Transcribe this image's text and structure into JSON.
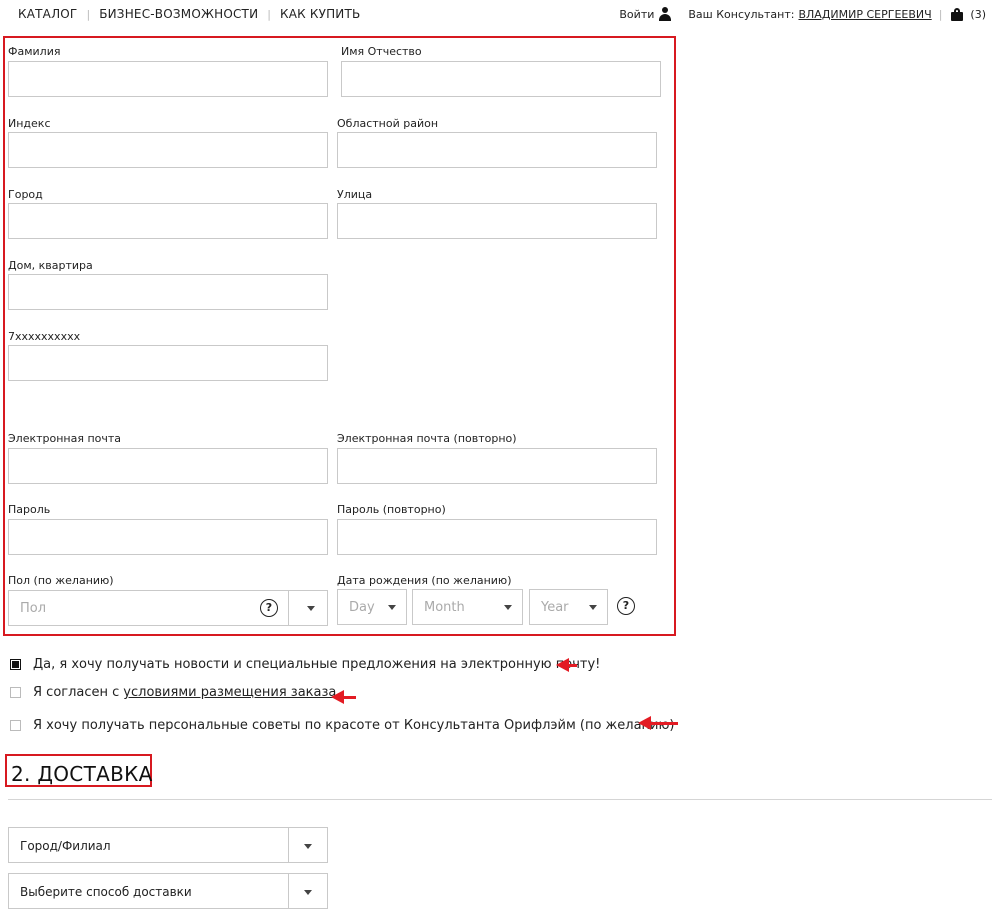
{
  "nav": {
    "items": [
      "КАТАЛОГ",
      "БИЗНЕС-ВОЗМОЖНОСТИ",
      "КАК КУПИТЬ"
    ],
    "login": "Войти",
    "consultant_label": "Ваш Консультант:",
    "consultant_name": "ВЛАДИМИР СЕРГЕЕВИЧ",
    "cart_count": "(3)"
  },
  "form": {
    "last_name_label": "Фамилия",
    "first_name_label": "Имя Отчество",
    "index_label": "Индекс",
    "region_label": "Областной район",
    "city_label": "Город",
    "street_label": "Улица",
    "house_label": "Дом, квартира",
    "phone_label": "7xxxxxxxxxx",
    "email_label": "Электронная почта",
    "email_repeat_label": "Электронная почта (повторно)",
    "password_label": "Пароль",
    "password_repeat_label": "Пароль (повторно)",
    "gender_label": "Пол (по желанию)",
    "gender_placeholder": "Пол",
    "birthdate_label": "Дата рождения (по желанию)",
    "day_placeholder": "Day",
    "month_placeholder": "Month",
    "year_placeholder": "Year",
    "help_symbol": "?"
  },
  "checkboxes": {
    "newsletter": "Да, я хочу получать новости и специальные предложения на электронную почту!",
    "newsletter_checked": true,
    "terms_prefix": "Я согласен с",
    "terms_link": "условиями размещения заказа",
    "terms_checked": false,
    "beauty_advice": "Я хочу получать персональные советы по красоте от Консультанта Орифлэйм (по желанию)",
    "beauty_checked": false
  },
  "delivery": {
    "section_title": "2. ДОСТАВКА",
    "city_branch": "Город/Филиал",
    "delivery_method": "Выберите способ доставки"
  },
  "colors": {
    "highlight": "#d71920",
    "arrow": "#e31b23",
    "border": "#c9c9c9"
  }
}
